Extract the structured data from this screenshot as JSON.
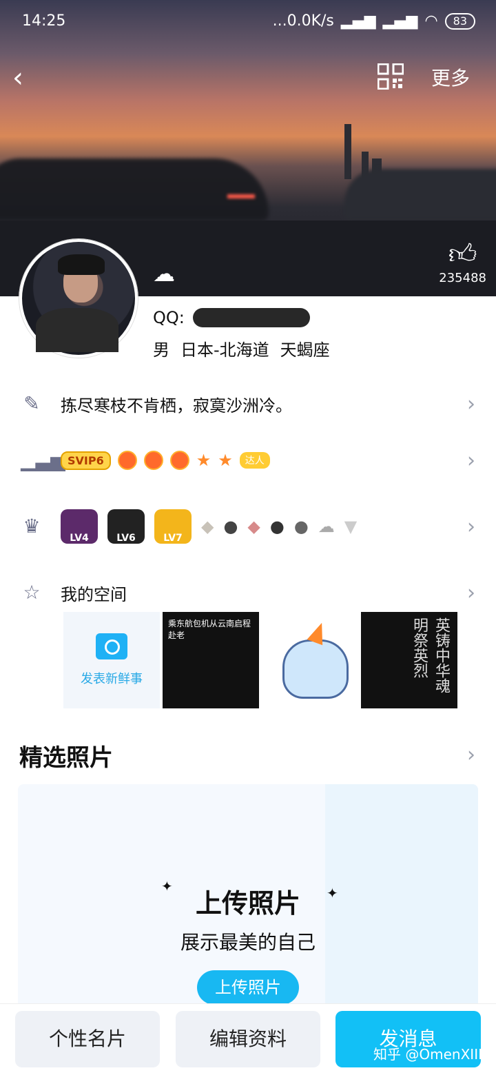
{
  "status": {
    "time": "14:25",
    "network": "...0.0K/s",
    "battery": "83"
  },
  "nav": {
    "back_icon": "←",
    "more_label": "更多"
  },
  "profile": {
    "like_count": "235488",
    "qq_label": "QQ:",
    "gender": "男",
    "location": "日本-北海道",
    "zodiac": "天蝎座"
  },
  "rows": {
    "signature": "拣尽寒枝不肯栖，寂寞沙洲冷。",
    "svip_label": "SVIP6",
    "daren_label": "达人",
    "my_space": "我的空间",
    "level_labels": [
      "LV4",
      "LV6",
      "LV7"
    ]
  },
  "space": {
    "new_post": "发表新鲜事",
    "tile2_title": "乘东航包机从云南启程赴老",
    "tile4_text": "英铸中华魂 明祭英烈"
  },
  "photos": {
    "title": "精选照片",
    "upload_title": "上传照片",
    "upload_sub": "展示最美的自己",
    "upload_btn": "上传照片"
  },
  "bottom": {
    "card": "个性名片",
    "edit": "编辑资料",
    "message": "发消息"
  },
  "watermark": "知乎 @OmenXIII"
}
